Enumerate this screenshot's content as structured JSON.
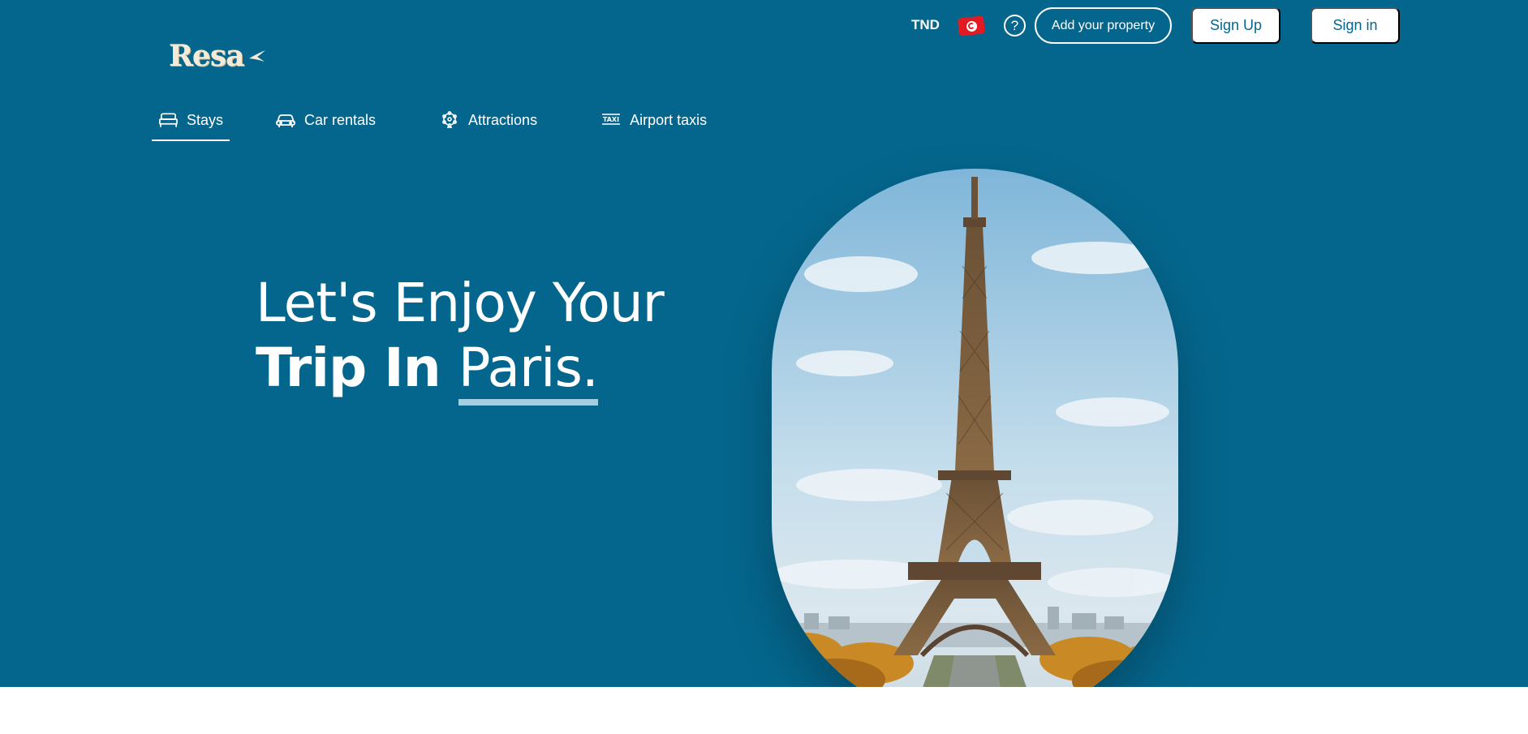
{
  "brand": {
    "name": "Resa"
  },
  "topbar": {
    "currency": "TND",
    "add_property_label": "Add your property",
    "sign_up_label": "Sign Up",
    "sign_in_label": "Sign in"
  },
  "nav": {
    "items": [
      {
        "label": "Stays",
        "icon": "bed-icon",
        "active": true
      },
      {
        "label": "Car rentals",
        "icon": "car-icon",
        "active": false
      },
      {
        "label": "Attractions",
        "icon": "ferris-wheel-icon",
        "active": false
      },
      {
        "label": "Airport taxis",
        "icon": "taxi-icon",
        "active": false
      }
    ]
  },
  "hero": {
    "line1": "Let's Enjoy Your",
    "line2_prefix": "Trip In",
    "city": "Paris",
    "suffix": "."
  },
  "colors": {
    "primary": "#05668d",
    "accent_underline": "#a9cde0",
    "flag_red": "#e21b23"
  }
}
